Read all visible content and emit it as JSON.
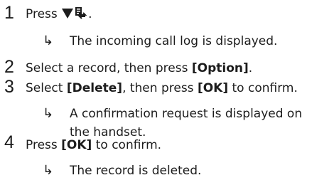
{
  "steps": [
    {
      "number": "1",
      "text_prefix": "Press ",
      "icon": "menu-down-call-log-icon",
      "text_suffix": ".",
      "result": "The incoming call log is displayed."
    },
    {
      "number": "2",
      "text_prefix": "Select a record, then press ",
      "bold1": "[Option]",
      "text_suffix": "."
    },
    {
      "number": "3",
      "text_prefix": "Select ",
      "bold1": "[Delete]",
      "text_middle": ", then press ",
      "bold2": "[OK]",
      "text_suffix": " to confirm.",
      "result_line1": "A confirmation request is displayed on",
      "result_line2": "the handset."
    },
    {
      "number": "4",
      "text_prefix": "Press ",
      "bold1": "[OK]",
      "text_suffix": " to confirm.",
      "result": "The record is deleted."
    }
  ],
  "result_arrow": "↳",
  "colors": {
    "text": "#1c1c1c"
  }
}
